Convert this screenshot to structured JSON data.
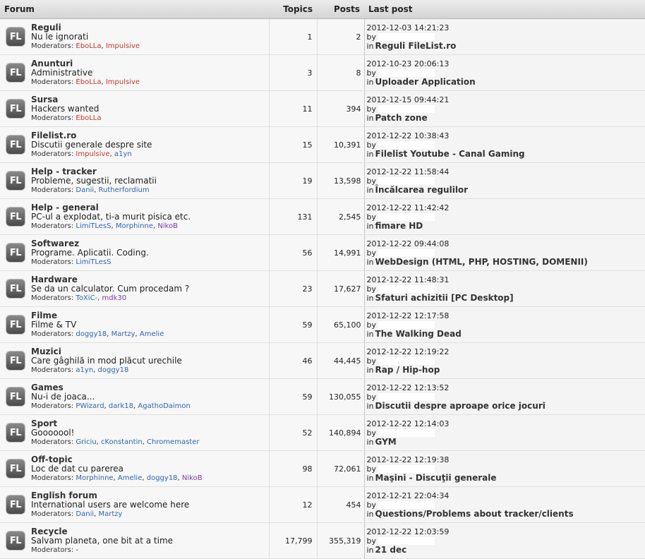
{
  "headers": {
    "forum": "Forum",
    "topics": "Topics",
    "posts": "Posts",
    "last_post": "Last post"
  },
  "icon_text": "FL",
  "mod_prefix": "Moderators: ",
  "by_label": "by",
  "in_label": "in",
  "forums": [
    {
      "name": "Reguli",
      "desc": "Nu le ignorati",
      "mods": [
        {
          "n": "EboLLa",
          "c": "red"
        },
        {
          "n": "Impulsive",
          "c": "red"
        }
      ],
      "topics": "1",
      "posts": "2",
      "date": "2012-12-03 14:21:23",
      "topic": "Reguli FileList.ro"
    },
    {
      "name": "Anunturi",
      "desc": "Administrative",
      "mods": [
        {
          "n": "EboLLa",
          "c": "red"
        },
        {
          "n": "Impulsive",
          "c": "red"
        }
      ],
      "topics": "3",
      "posts": "8",
      "date": "2012-10-23 20:06:13",
      "topic": "Uploader Application"
    },
    {
      "name": "Sursa",
      "desc": "Hackers wanted",
      "mods": [
        {
          "n": "EboLLa",
          "c": "red"
        }
      ],
      "topics": "11",
      "posts": "394",
      "date": "2012-12-15 09:44:21",
      "topic": "Patch zone"
    },
    {
      "name": "Filelist.ro",
      "desc": "Discutii generale despre site",
      "mods": [
        {
          "n": "Impulsive",
          "c": "red"
        },
        {
          "n": "a1yn",
          "c": "blue"
        }
      ],
      "topics": "15",
      "posts": "10,391",
      "date": "2012-12-22 10:38:43",
      "topic": "Filelist Youtube - Canal Gaming"
    },
    {
      "name": "Help - tracker",
      "desc": "Probleme, sugestii, reclamatii",
      "mods": [
        {
          "n": "Danii",
          "c": "blue"
        },
        {
          "n": "Rutherfordium",
          "c": "blue"
        }
      ],
      "topics": "19",
      "posts": "13,598",
      "date": "2012-12-22 11:58:44",
      "topic": "Încălcarea regulilor"
    },
    {
      "name": "Help - general",
      "desc": "PC-ul a explodat, ti-a murit pisica etc.",
      "mods": [
        {
          "n": "LimiTLesS",
          "c": "blue"
        },
        {
          "n": "Morphinne",
          "c": "blue"
        },
        {
          "n": "NikoB",
          "c": "purple"
        }
      ],
      "topics": "131",
      "posts": "2,545",
      "date": "2012-12-22 11:42:42",
      "topic": "fimare HD"
    },
    {
      "name": "Softwarez",
      "desc": "Programe. Aplicatii. Coding.",
      "mods": [
        {
          "n": "LimiTLesS",
          "c": "blue"
        }
      ],
      "topics": "56",
      "posts": "14,991",
      "date": "2012-12-22 09:44:08",
      "topic": "WebDesign (HTML, PHP, HOSTING, DOMENII)"
    },
    {
      "name": "Hardware",
      "desc": "Se da un calculator. Cum procedam ?",
      "mods": [
        {
          "n": "ToXiC-",
          "c": "blue"
        },
        {
          "n": "mdk30",
          "c": "purple"
        }
      ],
      "topics": "23",
      "posts": "17,627",
      "date": "2012-12-22 11:48:31",
      "topic": "Sfaturi achizitii [PC Desktop]"
    },
    {
      "name": "Filme",
      "desc": "Filme & TV",
      "mods": [
        {
          "n": "doggy18",
          "c": "blue"
        },
        {
          "n": "Martzy",
          "c": "blue"
        },
        {
          "n": "Amelie",
          "c": "blue"
        }
      ],
      "topics": "59",
      "posts": "65,100",
      "date": "2012-12-22 12:17:58",
      "topic": "The Walking Dead"
    },
    {
      "name": "Muzici",
      "desc": "Care gâghilă in mod plăcut urechile",
      "mods": [
        {
          "n": "a1yn",
          "c": "blue"
        },
        {
          "n": "doggy18",
          "c": "blue"
        }
      ],
      "topics": "46",
      "posts": "44,445",
      "date": "2012-12-22 12:19:22",
      "topic": "Rap / Hip-hop"
    },
    {
      "name": "Games",
      "desc": "Nu-i de joaca...",
      "mods": [
        {
          "n": "PWizard",
          "c": "blue"
        },
        {
          "n": "dark18",
          "c": "blue"
        },
        {
          "n": "AgathoDaimon",
          "c": "blue"
        }
      ],
      "topics": "59",
      "posts": "130,055",
      "date": "2012-12-22 12:13:52",
      "topic": "Discutii despre aproape orice jocuri"
    },
    {
      "name": "Sport",
      "desc": "Gooooool!",
      "mods": [
        {
          "n": "Griciu",
          "c": "blue"
        },
        {
          "n": "cKonstantin",
          "c": "blue"
        },
        {
          "n": "Chromemaster",
          "c": "blue"
        }
      ],
      "topics": "52",
      "posts": "140,894",
      "date": "2012-12-22 12:14:03",
      "topic": "GYM"
    },
    {
      "name": "Off-topic",
      "desc": "Loc de dat cu parerea",
      "mods": [
        {
          "n": "Morphinne",
          "c": "blue"
        },
        {
          "n": "Amelie",
          "c": "blue"
        },
        {
          "n": "doggy18",
          "c": "blue"
        },
        {
          "n": "NikoB",
          "c": "purple"
        }
      ],
      "topics": "98",
      "posts": "72,061",
      "date": "2012-12-22 12:19:38",
      "topic": "Maşini - Discuţii generale"
    },
    {
      "name": "English forum",
      "desc": "International users are welcome here",
      "mods": [
        {
          "n": "Danii",
          "c": "blue"
        },
        {
          "n": "Martzy",
          "c": "blue"
        }
      ],
      "topics": "12",
      "posts": "454",
      "date": "2012-12-21 22:04:34",
      "topic": "Questions/Problems about tracker/clients"
    },
    {
      "name": "Recycle",
      "desc": "Salvam planeta, one bit at a time",
      "mods": [],
      "mods_text": "-",
      "topics": "17,799",
      "posts": "355,319",
      "date": "2012-12-22 12:03:59",
      "topic": "21 dec"
    }
  ]
}
